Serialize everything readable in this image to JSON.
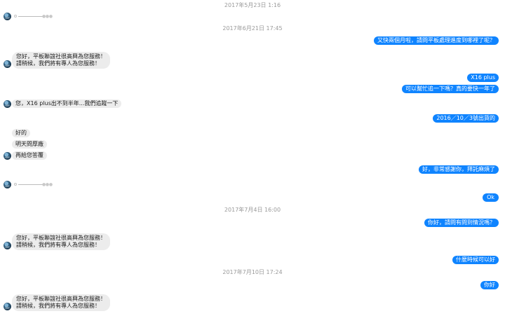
{
  "timestamps": {
    "t1": "2017年5月23日 1:16",
    "t2": "2017年6月21日 17:45",
    "t3": "2017年7月4日 16:00",
    "t4": "2017年7月10日 17:24"
  },
  "top_clip": "··· ···",
  "typing_label": "●●●",
  "messages": {
    "out1": "又快兩個月啦，請問平板處理進度到哪裡了呢？",
    "in_auto_1a": "您好，平板聯誼社很高興為您服務！",
    "in_auto_1b": "請稍候，我們將有專人為您服務！",
    "out2": "X16 plus",
    "out3": "可以幫忙追一下嗎？真的要快一年了",
    "in2": "您，X16 plus出不到半年...我們追蹤一下",
    "out4": "2016／10／3號出貨的",
    "in3": "好的",
    "in4": "明天問厚廠",
    "in5": "再給您答覆",
    "out5": "好，非常感謝你，拜託麻煩了",
    "out6": "Ok",
    "out7": "你好，請問有問到情況嗎？",
    "in_auto_2a": "您好，平板聯誼社很高興為您服務！",
    "in_auto_2b": "請稍候，我們將有專人為您服務！",
    "out8": "什麼時候可以好",
    "out9": "你好",
    "in_auto_3a": "您好，平板聯誼社很高興為您服務！",
    "in_auto_3b": "請稍候，我們將有專人為您服務！"
  },
  "colors": {
    "outgoing_bubble": "#0f84ff",
    "incoming_bubble": "#ececec",
    "timestamp_text": "#9a9a9a"
  },
  "icons": {
    "avatar": "globe-avatar-icon",
    "typing": "typing-indicator-icon"
  }
}
